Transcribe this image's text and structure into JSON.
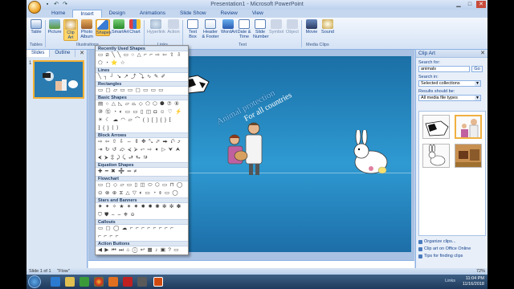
{
  "window": {
    "title": "Presentation1 - Microsoft PowerPoint",
    "qat_icons": [
      "save-icon",
      "undo-icon",
      "redo-icon"
    ]
  },
  "ribbon_tabs": [
    "Home",
    "Insert",
    "Design",
    "Animations",
    "Slide Show",
    "Review",
    "View"
  ],
  "active_tab": "Insert",
  "ribbon": {
    "buttons": [
      "Table",
      "Picture",
      "Clip Art",
      "Photo Album",
      "Shapes",
      "SmartArt",
      "Chart",
      "Hyperlink",
      "Action",
      "Text Box",
      "Header & Footer",
      "WordArt",
      "Date & Time",
      "Slide Number",
      "Symbol",
      "Object",
      "Movie",
      "Sound"
    ],
    "groups": [
      "Tables",
      "Illustrations",
      "Links",
      "Text",
      "Media Clips"
    ]
  },
  "left_panel": {
    "tabs": [
      "Slides",
      "Outline"
    ],
    "slide_number": "1"
  },
  "shapes_menu": {
    "categories": [
      {
        "name": "Recently Used Shapes",
        "rows": [
          "▭ ⧄ ╲ ╲ ▭ ○ △ ⌐ ⌐ ⇨ ⇦ ⇧ ⇩",
          "⬠ ◔ ⭐ ☆"
        ]
      },
      {
        "name": "Lines",
        "rows": [
          "╲ ┐ ┘ ↘ ↗ ⤴ ⤵ ∿ ✎ ✐"
        ]
      },
      {
        "name": "Rectangles",
        "rows": [
          "▭ ▢ ▱ ▭ ▭ ▢ ▭ ▭ ▭"
        ]
      },
      {
        "name": "Basic Shapes",
        "rows": [
          "▤ ○ △ ◺ ▱ ⏢ ◇ ⬠ ⬡ ⯃ ⑦ ⑧",
          "⑩ ⑫ ◔ ◐ ▭ ▭ ▯ ◫ ◘ ☺ ♡ ⚡",
          "☀ ☾ ☁ ◠ ▱ ⌒ ( ) [ ] { } ⁅",
          "⁆ { } ⟨ ⟩"
        ]
      },
      {
        "name": "Block Arrows",
        "rows": [
          "⇨ ⇦ ⇧ ⇩ ⇔ ⇕ ✥ ⤡ ⬀ ⮕ ⮏ ⤴",
          "⇥ ↻ ↺ ⤽ ⮘ ⮚ ⬿ ⇨ ➧ ▷ ⮟ ⮝",
          "⮜ ⮞ ⇳ ⤸ ⤹ ⮐ ⮑ ⮒"
        ]
      },
      {
        "name": "Equation Shapes",
        "rows": [
          "✚ ━ ✖ ➗ ═ ≠"
        ]
      },
      {
        "name": "Flowchart",
        "rows": [
          "▭ ▢ ◇ ▱ ▭ ▯ ◫ ⬭ ⬡ ▭ ⊓ ◯",
          "⊙ ⊗ ⊕ ⧖ △ ▽ ◐ ▭ ◔ ⌽ ▭ ◯"
        ]
      },
      {
        "name": "Stars and Banners",
        "rows": [
          "✷ ✦ ✧ ★ ✶ ✷ ✸ ✹ ✺ ✻ ✼ ✽",
          "⛉ ⛊ ⌢ ⌣ ⎈ ⎉"
        ]
      },
      {
        "name": "Callouts",
        "rows": [
          "▭ ▢ ◯ ☁ ⌐ ⌐ ⌐ ⌐ ⌐ ⌐ ⌐ ⌐",
          "⌐ ⌐ ⌐ ⌐"
        ]
      },
      {
        "name": "Action Buttons",
        "rows": [
          "◀ ▶ ⏮ ⏭ ⌂ ⓘ ↩ ▦ ♪ ▣ ? ▭"
        ]
      }
    ]
  },
  "slide": {
    "title_line1": "Animal protection",
    "title_line2": "For all countries"
  },
  "clip_art": {
    "pane_title": "Clip Art",
    "search_label": "Search for:",
    "search_value": "animals",
    "go_label": "Go",
    "search_in_label": "Search in:",
    "search_in_value": "Selected collections",
    "results_label": "Results should be:",
    "results_value": "All media file types",
    "links": [
      "Organize clips...",
      "Clip art on Office Online",
      "Tips for finding clips"
    ]
  },
  "status_bar": {
    "slide_info": "Slide 1 of 1",
    "theme": "\"Flow\"",
    "zoom": "72%"
  },
  "taskbar": {
    "tray_text": "Links",
    "time": "11:04 PM",
    "date": "11/16/2018"
  }
}
